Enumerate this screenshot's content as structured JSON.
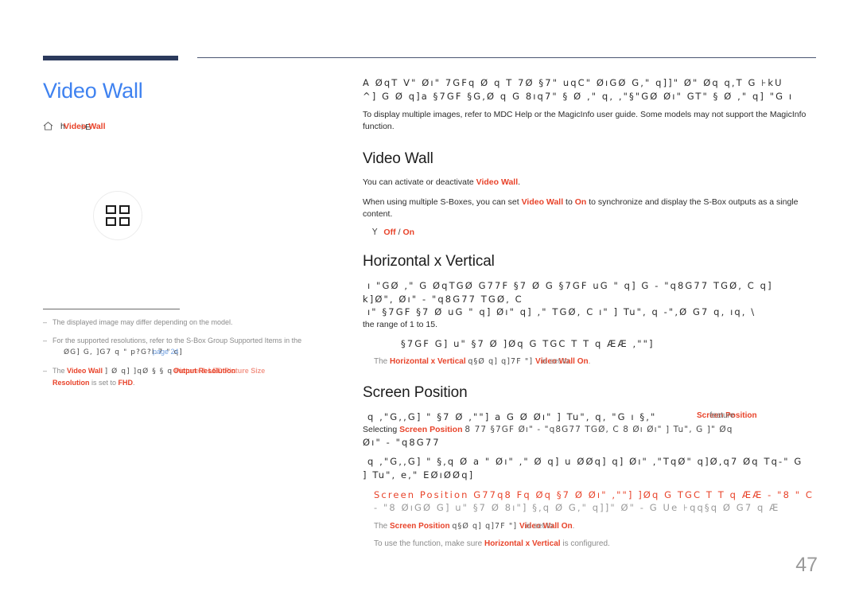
{
  "document": {
    "page_number": "47",
    "page_title": "Video Wall"
  },
  "breadcrumb": {
    "home_icon": "home-icon",
    "ghost_text": "h",
    "current": "Video Wall",
    "tail": "⊦E"
  },
  "sidebar": {
    "feature_icon": "video-wall-grid-icon",
    "notes": [
      {
        "dash": "–",
        "text": "The displayed image may differ depending on the model."
      },
      {
        "dash": "–",
        "text": "For the supported resolutions, refer to the S-Box Group Supported Items in the",
        "garbled_line": "ØG] G,      ]G7  q \" p?G?l.7 \" q]",
        "link": "page 24"
      },
      {
        "dash": "–",
        "lead": "The",
        "term1": "Video Wall",
        "garbled_mid": "] Ø q]      ]qØ     § § q",
        "overlay_terms": "Picture  &  LED Picture Size",
        "term2": "Output Resolution",
        "tail": "is set to",
        "term3": "FHD",
        "period": "."
      }
    ]
  },
  "content": {
    "intro": {
      "garbled_lines": [
        "A   ØqT V\" Øı\" 7GFq Ø q  T 7Ø §7\"   uqC\"  ØıGØ G,\"  q]]\" Ø\"  Øq  q,T G ⊦kU",
        "^] G   Ø q]a    §7GF §G,Ø q  G 8ıq7\" §  Ø ,\" q, ,\"§\"GØ Øı\"  GT\" §  Ø ,\" q] \"G ı"
      ],
      "paragraph": "To display multiple images, refer to MDC Help or the MagicInfo user guide. Some models may not support the MagicInfo function."
    },
    "sections": [
      {
        "heading": "Video Wall",
        "paragraphs": [
          {
            "pre": "You can activate or deactivate ",
            "term": "Video Wall",
            "post": "."
          },
          {
            "pre": "When using multiple S-Boxes, you can set ",
            "term": "Video Wall",
            "mid": " to ",
            "term2": "On",
            "post": " to synchronize and display the S-Box outputs as a single content."
          }
        ],
        "options": {
          "bullet": "Y",
          "values": [
            "Off",
            "On"
          ],
          "separator": "/"
        }
      },
      {
        "heading": "Horizontal x Vertical",
        "garbled_lines": [
          "ı    \"GØ ,\" G ØqTGØ  G77F  §7 Ø  G    §7GF uG \"  q] G -  \"q8G77 TGØ, C  q]",
          "k]Ø\", Øı\" -  \"q8G77 TGØ, C",
          "ı\"    §7GF     §7 Ø uG \"  q] Øı\"  q]     ,\"  TGØ, C   ı\" ] Tu\", q  -\",Ø  G7 q, ıq, \\"
        ],
        "tail_text": "the range of 1 to 15.",
        "garbled_indent": "§7GF   G] u\"  §7 Ø  ]Øq G TGC T T q   ÆÆ   ,\"\"]",
        "subnote": {
          "pre": "The ",
          "term": "Horizontal x Vertical",
          "garbled_mid": "q§Ø q]      q]7F \"]",
          "overlay": "Video Wall",
          "tail": "is set to",
          "term2": "On",
          "post": "."
        }
      },
      {
        "heading": "Screen Position",
        "garbled_lines": [
          "q ,\"G,,G] \"  §7 Ø   ,\"\"] a G    Ø Øı\" ] Tu\", q, \"G ı §,\"",
          "Øı\" -  \"q8G77"
        ],
        "overlay_inline_1": {
          "term": "Screen Position",
          "ghost": "feature"
        },
        "line2": {
          "pre": "Selecting ",
          "term": "Screen Position",
          "garbled": "8 77    §7GF Øı\" -  \"q8G77 TGØ, C 8 Øı Øı\" ] Tu\", G    ]\"  Øq"
        },
        "garbled_lines_2": [
          "q ,\"G,,G] \" §,q  Ø a   \" Øı\"  ,\" Ø q] u ØØq]  q] Øı\" ,\"TqØ\"  q]Ø,q7 Øq Tq-\" G",
          "] Tu\", e,\" EØıØØq]"
        ],
        "garbled_red": [
          "Screen Position G77q8  Fq  Øq §7 Ø Øı\"   ,\"\"]  ]Øq G TGC T T q   ÆÆ - \"8  \"  C",
          "- \"8  ØıGØ  G] u\"  §7 Ø 8ı\"] §,q   Ø  G,\"  q]]\" Ø\"  - G Ue ⊦qq§q Ø    G7 q  Æ"
        ],
        "subnote": {
          "pre": "The ",
          "term": "Screen Position",
          "garbled_mid": "q§Ø q]      q]7F \"]",
          "overlay": "Video Wall",
          "tail": "is set to",
          "term2": "On",
          "post": "."
        },
        "final_note": {
          "pre": "To use the function, make sure ",
          "term": "Horizontal x Vertical",
          "post": " is configured."
        }
      }
    ]
  },
  "colors": {
    "title_blue": "#3f82f0",
    "accent_red": "#e8432a",
    "rule_navy": "#2b3a5c",
    "body_text": "#2b2b2b",
    "note_gray": "#8b8b8b",
    "link_blue": "#6f9fe0"
  }
}
